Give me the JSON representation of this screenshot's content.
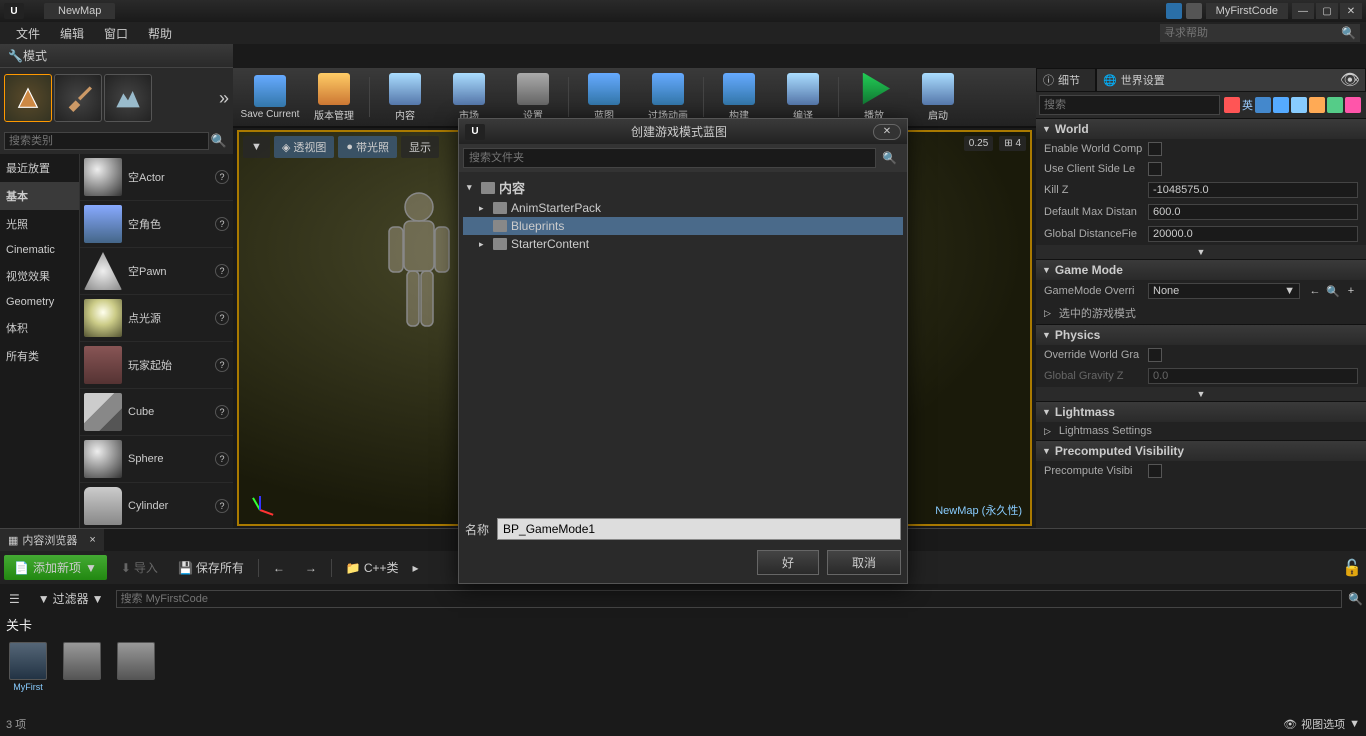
{
  "titlebar": {
    "map_name": "NewMap",
    "project_name": "MyFirstCode"
  },
  "menu": {
    "file": "文件",
    "edit": "编辑",
    "window": "窗口",
    "help": "帮助",
    "help_placeholder": "寻求帮助"
  },
  "modes": {
    "tab_label": "模式",
    "search_placeholder": "搜索类别",
    "categories": [
      "最近放置",
      "基本",
      "光照",
      "Cinematic",
      "视觉效果",
      "Geometry",
      "体积",
      "所有类"
    ],
    "selected_category": "基本",
    "actors": [
      "空Actor",
      "空角色",
      "空Pawn",
      "点光源",
      "玩家起始",
      "Cube",
      "Sphere",
      "Cylinder"
    ]
  },
  "toolbar": {
    "save": "Save Current",
    "version": "版本管理",
    "content": "内容",
    "market": "市场",
    "settings": "设置",
    "blueprint": "蓝图",
    "cinematic": "过场动画",
    "build": "构建",
    "compile": "编译",
    "play": "播放",
    "launch": "启动"
  },
  "viewport": {
    "dropdown": "▼",
    "perspective": "透视图",
    "lit": "带光照",
    "show": "显示",
    "speed_val": "0.25",
    "grid_val": "4",
    "label": "NewMap (永久性)"
  },
  "details": {
    "tab1": "细节",
    "tab2": "世界设置",
    "search_placeholder": "搜索",
    "world": {
      "title": "World",
      "enable_comp": "Enable World Comp",
      "client_side": "Use Client Side Le",
      "killz": "Kill Z",
      "killz_val": "-1048575.0",
      "maxdist": "Default Max Distan",
      "maxdist_val": "600.0",
      "gdf": "Global DistanceFie",
      "gdf_val": "20000.0"
    },
    "gamemode": {
      "title": "Game Mode",
      "override": "GameMode Overri",
      "override_val": "None",
      "selected": "选中的游戏模式"
    },
    "physics": {
      "title": "Physics",
      "override": "Override World Gra",
      "gravity": "Global Gravity Z",
      "gravity_val": "0.0"
    },
    "lightmass": {
      "title": "Lightmass",
      "settings": "Lightmass Settings"
    },
    "precomp": {
      "title": "Precomputed Visibility",
      "vis": "Precompute Visibi"
    }
  },
  "content_browser": {
    "tab": "内容浏览器",
    "addnew": "添加新项",
    "import": "导入",
    "saveall": "保存所有",
    "cpp": "C++类",
    "filter": "过滤器",
    "search_placeholder": "搜索 MyFirstCode",
    "path": "关卡",
    "assets": [
      "MyFirst",
      "",
      ""
    ],
    "count": "3 项",
    "viewopt": "视图选项"
  },
  "modal": {
    "title": "创建游戏模式蓝图",
    "search_placeholder": "搜索文件夹",
    "root": "内容",
    "folders": [
      "AnimStarterPack",
      "Blueprints",
      "StarterContent"
    ],
    "selected_folder": "Blueprints",
    "name_label": "名称",
    "name_value": "BP_GameMode1",
    "ok": "好",
    "cancel": "取消"
  }
}
